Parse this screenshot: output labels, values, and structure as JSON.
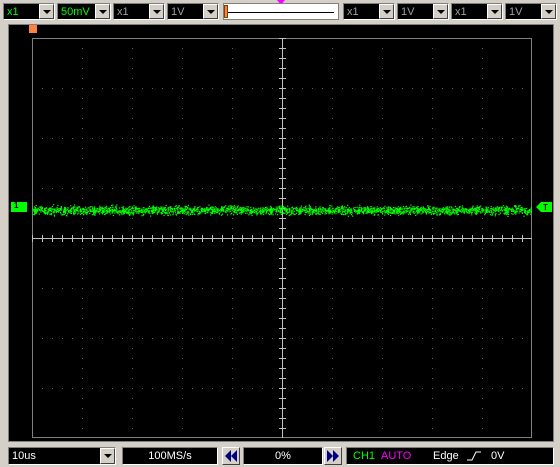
{
  "toolbar": {
    "ch1_probe": "x1",
    "ch1_volts": "50mV",
    "ch2_probe": "x1",
    "ch2_volts": "1V",
    "ch3_probe": "x1",
    "ch3_volts": "1V",
    "ch4_probe": "x1",
    "ch4_volts": "1V"
  },
  "screen": {
    "channel_marker": "1",
    "trigger_marker": "T",
    "trace_color": "#00ff00"
  },
  "status": {
    "timebase": "10us",
    "sample_rate": "100MS/s",
    "position": "0%",
    "trigger_channel": "CH1",
    "trigger_mode": "AUTO",
    "trigger_type": "Edge",
    "trigger_slope_icon": "rising-edge-icon",
    "trigger_level": "0V"
  }
}
